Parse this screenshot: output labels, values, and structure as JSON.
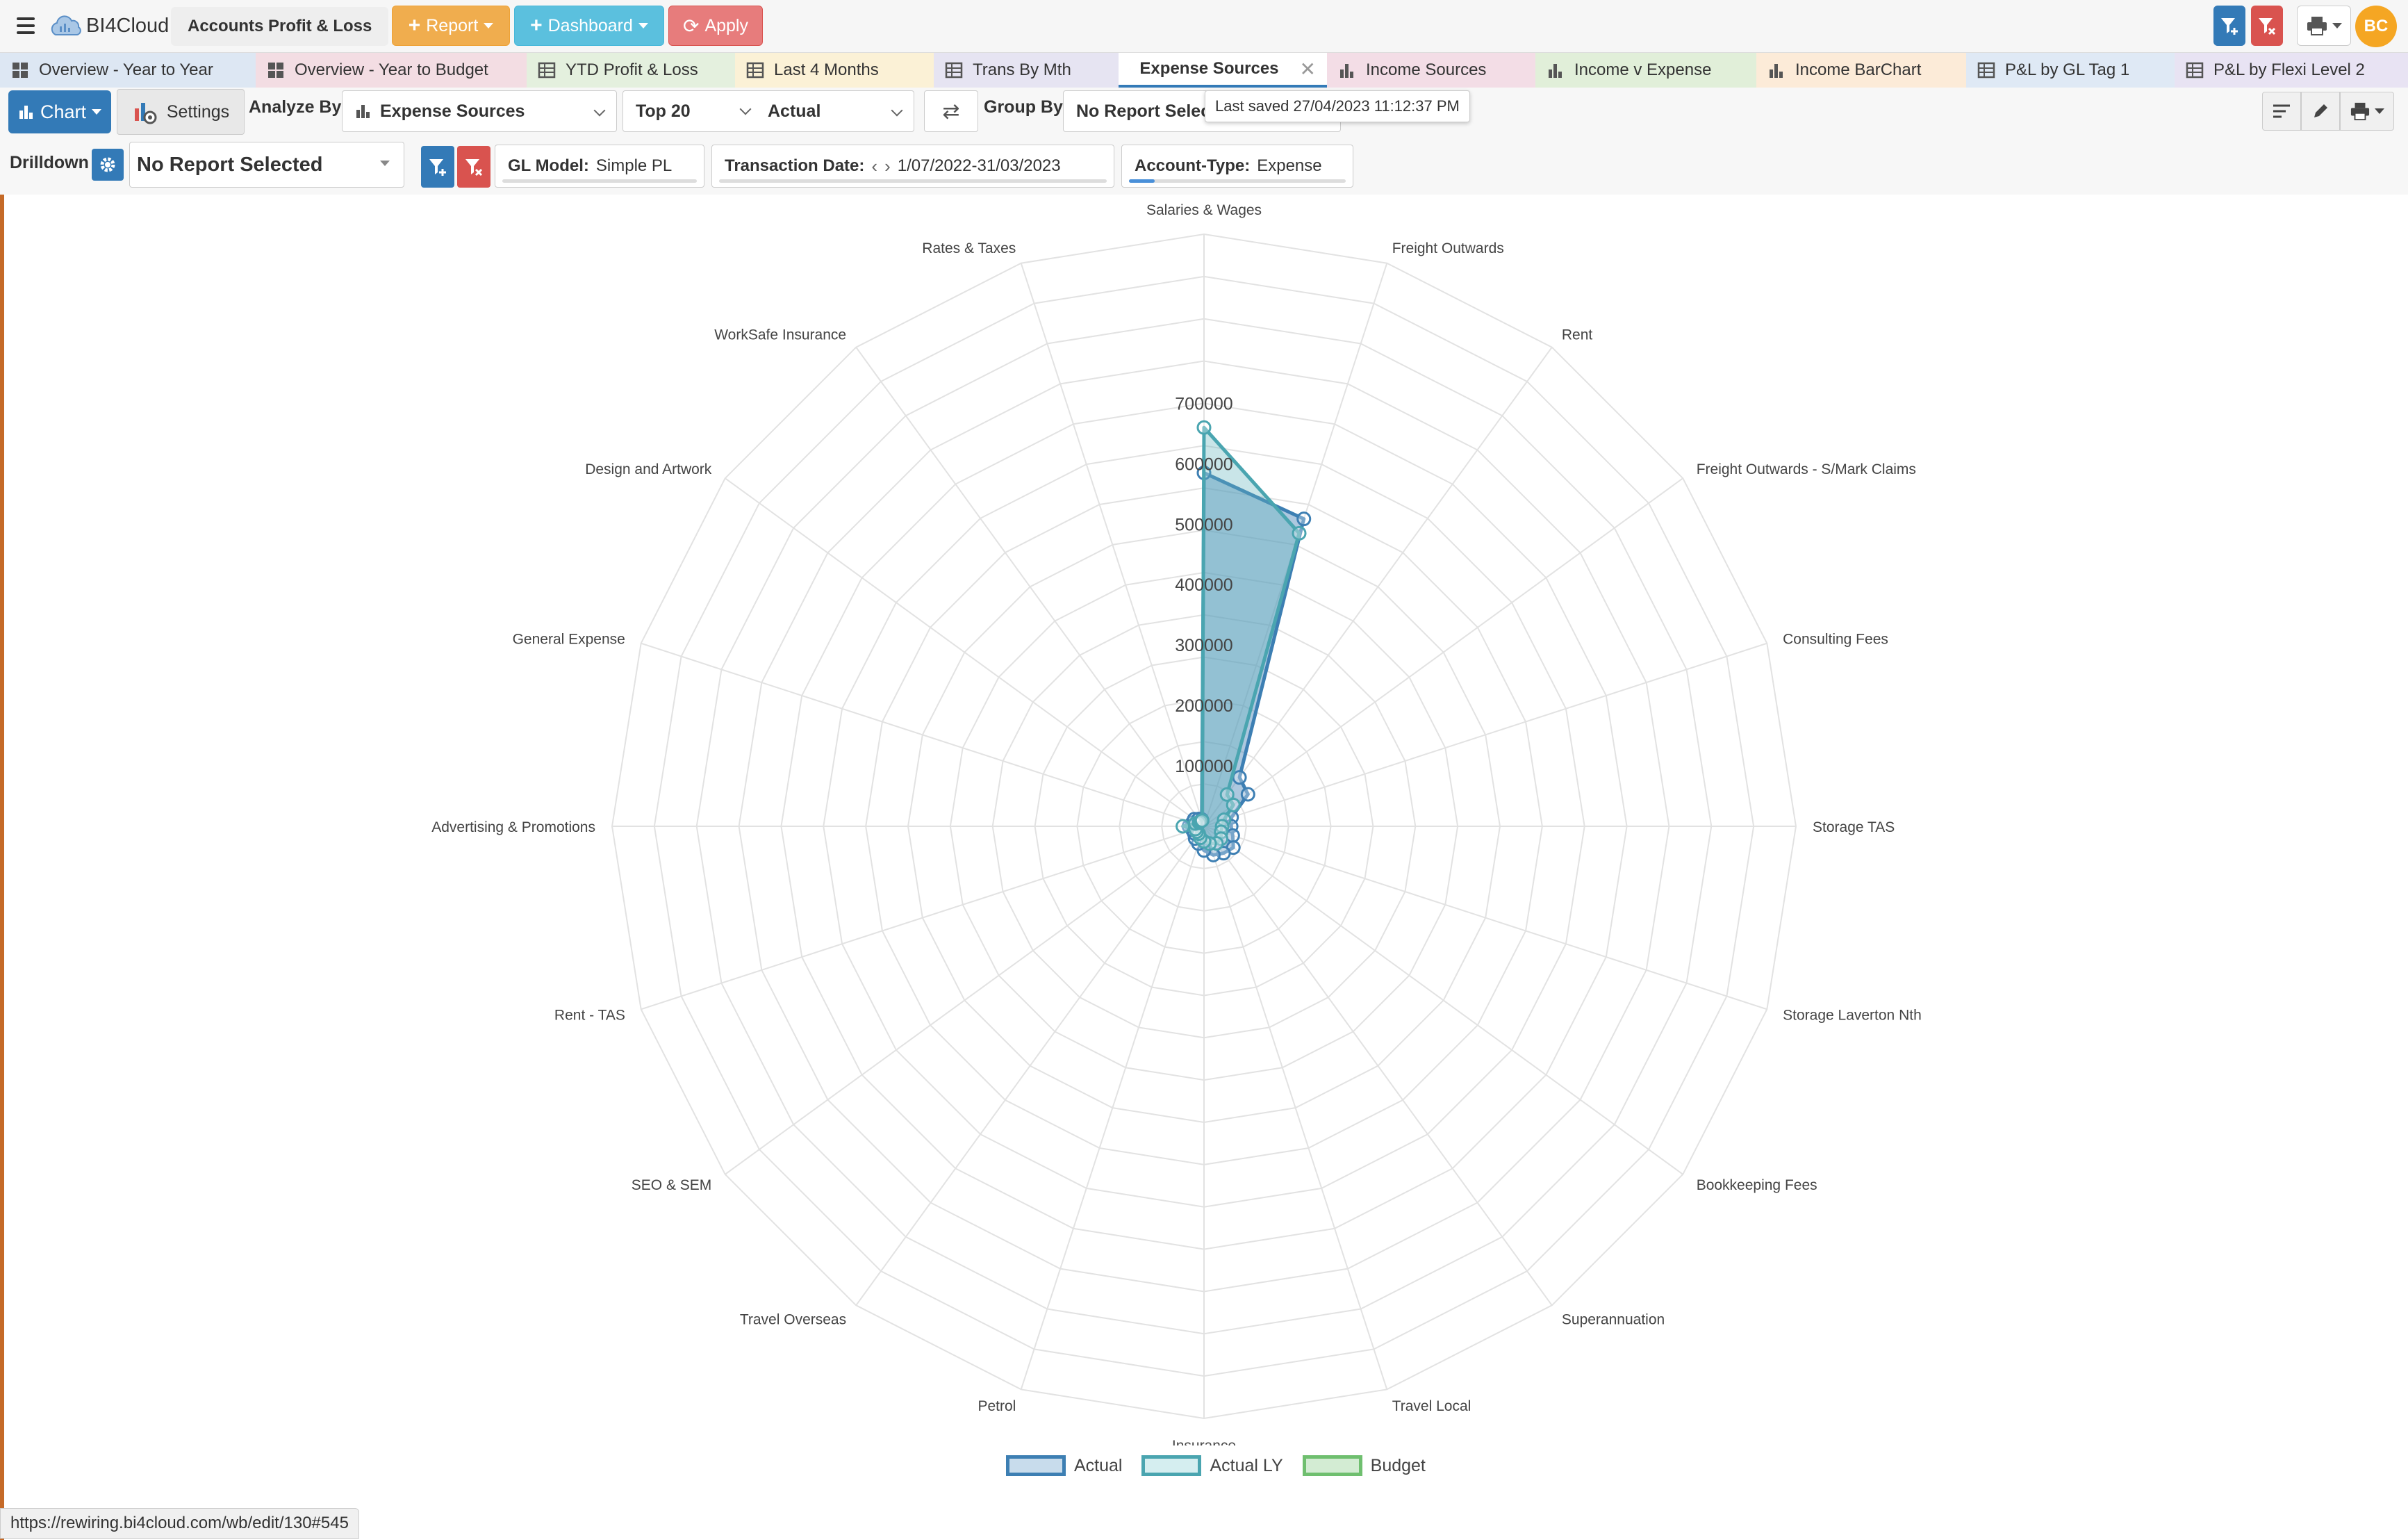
{
  "app": {
    "name": "BI4Cloud",
    "title": "Accounts Profit & Loss"
  },
  "top_buttons": {
    "report": "Report",
    "dashboard": "Dashboard",
    "apply": "Apply"
  },
  "user": {
    "initials": "BC"
  },
  "tabs": [
    {
      "label": "Overview - Year to Year",
      "icon": "dashboard-icon",
      "color": "#dde7f3"
    },
    {
      "label": "Overview - Year to Budget",
      "icon": "dashboard-icon",
      "color": "#f3dde3"
    },
    {
      "label": "YTD Profit & Loss",
      "icon": "table-icon",
      "color": "#e4f0de"
    },
    {
      "label": "Last 4 Months",
      "icon": "table-icon",
      "color": "#fbf1d6"
    },
    {
      "label": "Trans By Mth",
      "icon": "table-icon",
      "color": "#e6e4f2"
    },
    {
      "label": "Expense Sources",
      "icon": "bar-chart-icon",
      "color": "#ffffff"
    },
    {
      "label": "Income Sources",
      "icon": "bar-chart-icon",
      "color": "#f3dde6"
    },
    {
      "label": "Income v Expense",
      "icon": "bar-chart-icon",
      "color": "#e1efd9"
    },
    {
      "label": "Income BarChart",
      "icon": "bar-chart-icon",
      "color": "#fcebd8"
    },
    {
      "label": "P&L by GL Tag 1",
      "icon": "table-icon",
      "color": "#dfe9f5"
    },
    {
      "label": "P&L by Flexi Level 2",
      "icon": "table-icon",
      "color": "#e8e3f3"
    }
  ],
  "toolbar": {
    "chart_label": "Chart",
    "settings_label": "Settings",
    "analyze_by_label": "Analyze By",
    "analyze_by_value": "Expense Sources",
    "top_value": "Top 20",
    "measure_value": "Actual",
    "group_by_label": "Group By",
    "group_by_value": "No Report Selec",
    "tooltip": "Last saved 27/04/2023 11:12:37 PM"
  },
  "drilldown": {
    "label": "Drilldown",
    "value": "No Report Selected"
  },
  "filters": {
    "gl_model_label": "GL Model:",
    "gl_model_value": "Simple PL",
    "txn_date_label": "Transaction Date:",
    "txn_date_value": "1/07/2022-31/03/2023",
    "account_type_label": "Account-Type:",
    "account_type_value": "Expense"
  },
  "chart_data": {
    "type": "radar",
    "categories": [
      "Salaries & Wages",
      "Freight Outwards",
      "Rent",
      "Freight Outwards - S/Mark Claims",
      "Consulting Fees",
      "Storage TAS",
      "Storage Laverton Nth",
      "Bookkeeping Fees",
      "Superannuation",
      "Travel Local",
      "Insurance",
      "Petrol",
      "Travel Overseas",
      "SEO & SEM",
      "Rent - TAS",
      "Advertising & Promotions",
      "General Expense",
      "Design and Artwork",
      "WorkSafe Insurance",
      "Rates & Taxes"
    ],
    "radial_ticks": [
      "100000",
      "200000",
      "300000",
      "400000",
      "500000",
      "600000",
      "700000"
    ],
    "rmax": 700000,
    "series": [
      {
        "name": "Actual",
        "color": "#3d7fb3",
        "fill": "rgba(74,134,184,0.45)",
        "values": [
          585000,
          535000,
          100000,
          90000,
          48000,
          45000,
          50000,
          60000,
          55000,
          50000,
          40000,
          30000,
          25000,
          20000,
          20000,
          25000,
          20000,
          20000,
          15000,
          12000
        ]
      },
      {
        "name": "Actual LY",
        "color": "#4aa5b0",
        "fill": "rgba(100,180,190,0.35)",
        "values": [
          660000,
          510000,
          65000,
          60000,
          35000,
          30000,
          30000,
          35000,
          35000,
          30000,
          25000,
          20000,
          15000,
          15000,
          15000,
          35000,
          15000,
          10000,
          10000,
          10000
        ]
      },
      {
        "name": "Budget",
        "color": "#6fbf6f",
        "fill": "rgba(140,200,140,0.3)",
        "values": [
          0,
          0,
          0,
          0,
          0,
          0,
          0,
          0,
          0,
          0,
          0,
          0,
          0,
          0,
          0,
          0,
          0,
          0,
          0,
          0
        ]
      }
    ],
    "legend_position": "bottom"
  },
  "status_url": "https://rewiring.bi4cloud.com/wb/edit/130#545"
}
